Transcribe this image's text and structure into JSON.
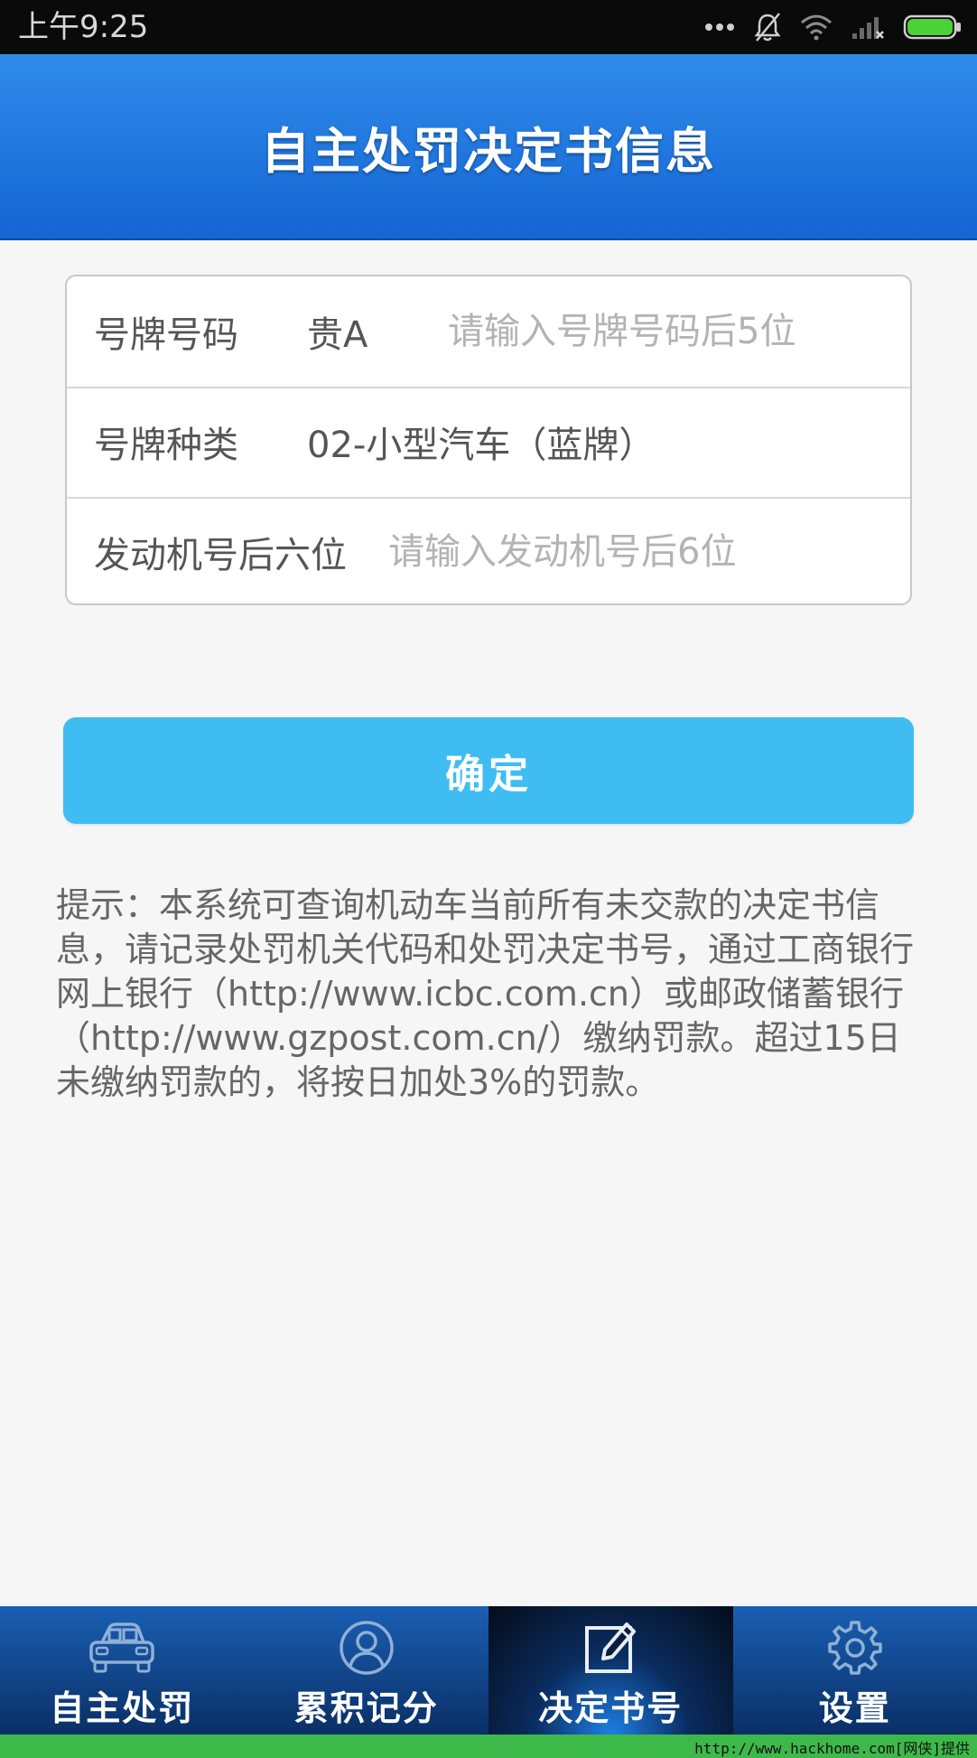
{
  "status_bar": {
    "time": "上午9:25",
    "icons": [
      "more-dots-icon",
      "bell-muted-icon",
      "wifi-icon",
      "signal-no-service-icon",
      "battery-icon"
    ],
    "battery_color": "#4cd137"
  },
  "header": {
    "title": "自主处罚决定书信息",
    "color": "#1e74de"
  },
  "form": {
    "plate_number": {
      "label": "号牌号码",
      "prefix": "贵A",
      "value": "",
      "placeholder": "请输入号牌号码后5位"
    },
    "plate_type": {
      "label": "号牌种类",
      "value": "02-小型汽车（蓝牌）"
    },
    "engine_number": {
      "label": "发动机号后六位",
      "value": "",
      "placeholder": "请输入发动机号后6位"
    }
  },
  "confirm_button": {
    "label": "确定",
    "color": "#3fbdf2"
  },
  "tip": "提示：本系统可查询机动车当前所有未交款的决定书信息，请记录处罚机关代码和处罚决定书号，通过工商银行网上银行（http://www.icbc.com.cn）或邮政储蓄银行（http://www.gzpost.com.cn/）缴纳罚款。超过15日未缴纳罚款的，将按日加处3%的罚款。",
  "bottom_nav": {
    "items": [
      {
        "label": "自主处罚",
        "icon": "car-icon",
        "active": false
      },
      {
        "label": "累积记分",
        "icon": "user-icon",
        "active": false
      },
      {
        "label": "决定书号",
        "icon": "edit-icon",
        "active": true
      },
      {
        "label": "设置",
        "icon": "gear-icon",
        "active": false
      }
    ]
  },
  "watermark": "http://www.hackhome.com[网侠]提供"
}
